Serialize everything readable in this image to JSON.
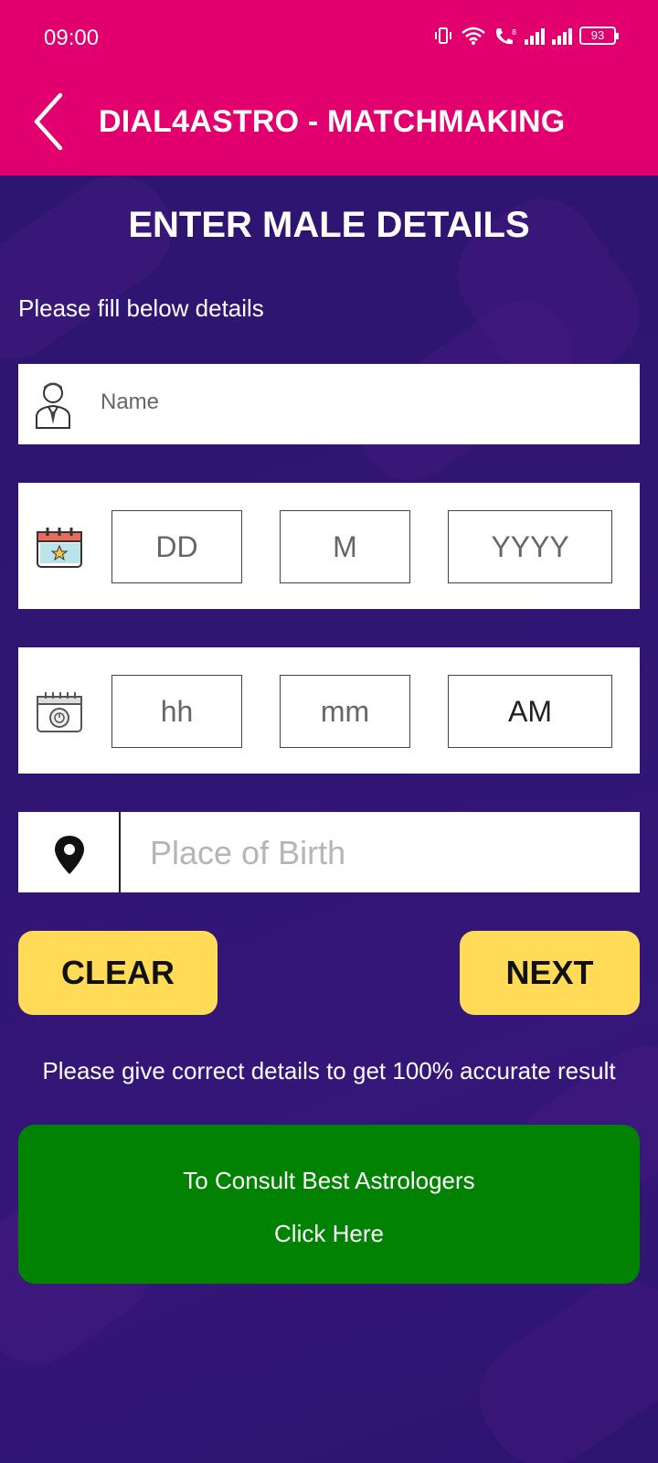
{
  "status_bar": {
    "time": "09:00",
    "battery": "93"
  },
  "header": {
    "title": "DIAL4ASTRO - MATCHMAKING",
    "back_icon": "chevron-left-icon"
  },
  "page": {
    "title": "ENTER MALE DETAILS",
    "subtitle": "Please fill below details"
  },
  "form": {
    "name": {
      "placeholder": "Name",
      "icon": "person-icon"
    },
    "date_of_birth": {
      "icon": "calendar-icon",
      "day": "DD",
      "month": "M",
      "year": "YYYY"
    },
    "time_of_birth": {
      "icon": "clock-calendar-icon",
      "hour": "hh",
      "minute": "mm",
      "ampm": "AM"
    },
    "place_of_birth": {
      "placeholder": "Place of Birth",
      "icon": "location-pin-icon"
    }
  },
  "buttons": {
    "clear": "CLEAR",
    "next": "NEXT"
  },
  "note": "Please give correct details to get 100% accurate result",
  "consult": {
    "line1": "To Consult Best Astrologers",
    "line2": "Click Here"
  },
  "colors": {
    "header": "#e2006f",
    "background": "#2e1572",
    "button_yellow": "#ffdb57",
    "consult_green": "#028202"
  }
}
